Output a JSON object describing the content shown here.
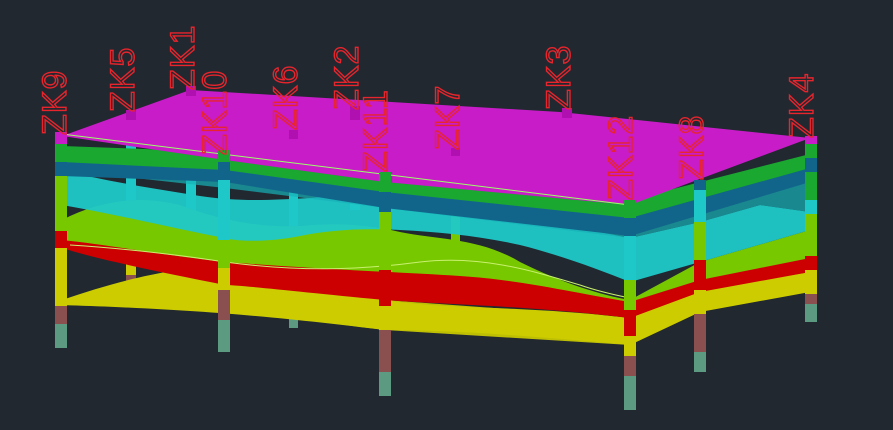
{
  "viewport": {
    "background": "#212830"
  },
  "boreholes": [
    {
      "id": "zk9",
      "label": "ZK9"
    },
    {
      "id": "zk5",
      "label": "ZK5"
    },
    {
      "id": "zk1",
      "label": "ZK1"
    },
    {
      "id": "zk10",
      "label": "ZK10"
    },
    {
      "id": "zk6",
      "label": "ZK6"
    },
    {
      "id": "zk2",
      "label": "ZK2"
    },
    {
      "id": "zk11",
      "label": "ZK11"
    },
    {
      "id": "zk7",
      "label": "ZK7"
    },
    {
      "id": "zk3",
      "label": "ZK3"
    },
    {
      "id": "zk12",
      "label": "ZK12"
    },
    {
      "id": "zk8",
      "label": "ZK8"
    },
    {
      "id": "zk4",
      "label": "ZK4"
    }
  ],
  "layer_colors": {
    "top": "#c81cc8",
    "green": "#1aa830",
    "blue": "#11658a",
    "cyan": "#1fc8c8",
    "lime": "#78c800",
    "red": "#cc0000",
    "yellow": "#cccc00",
    "brown": "#8a5050",
    "gray": "#5c9a82"
  }
}
